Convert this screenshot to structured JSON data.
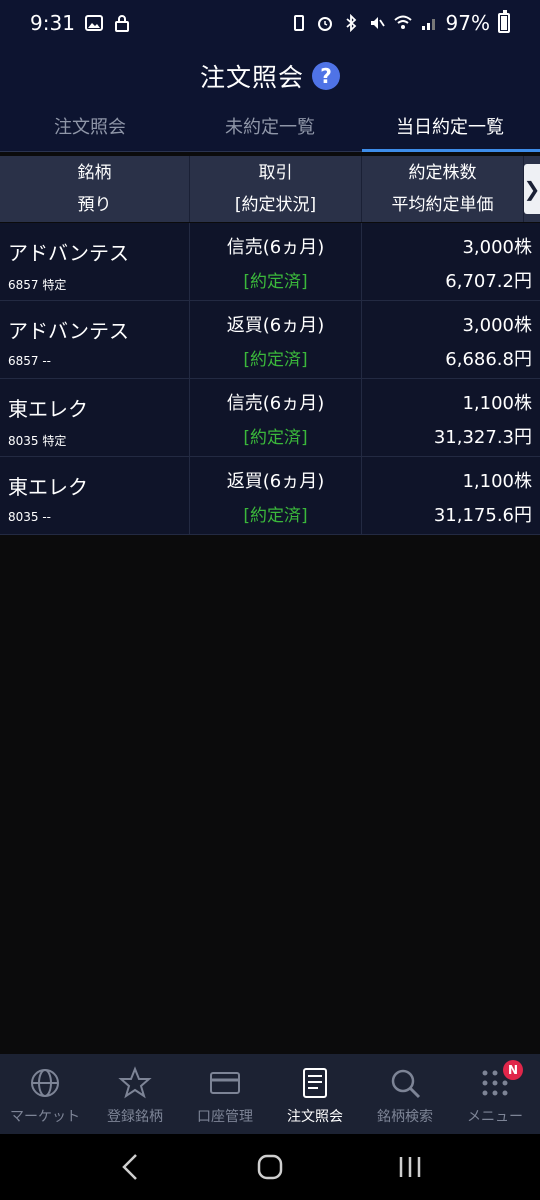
{
  "status_bar": {
    "time": "9:31",
    "battery": "97%"
  },
  "header": {
    "title": "注文照会",
    "help_icon": "question-icon",
    "accent_color": "#4f73e6"
  },
  "tabs": [
    {
      "label": "注文照会",
      "active": false
    },
    {
      "label": "未約定一覧",
      "active": false
    },
    {
      "label": "当日約定一覧",
      "active": true
    }
  ],
  "table": {
    "headers": {
      "col1_top": "銘柄",
      "col1_bottom": "預り",
      "col2_top": "取引",
      "col2_bottom": "[約定状況]",
      "col3_top": "約定株数",
      "col3_bottom": "平均約定単価",
      "scroll_arrow": "❯"
    },
    "rows": [
      {
        "name": "アドバンテス",
        "code": "6857 特定",
        "trade": "信売(6ヵ月)",
        "status": "[約定済]",
        "qty": "3,000株",
        "price": "6,707.2円"
      },
      {
        "name": "アドバンテス",
        "code": "6857 --",
        "trade": "返買(6ヵ月)",
        "status": "[約定済]",
        "qty": "3,000株",
        "price": "6,686.8円"
      },
      {
        "name": "東エレク",
        "code": "8035 特定",
        "trade": "信売(6ヵ月)",
        "status": "[約定済]",
        "qty": "1,100株",
        "price": "31,327.3円"
      },
      {
        "name": "東エレク",
        "code": "8035 --",
        "trade": "返買(6ヵ月)",
        "status": "[約定済]",
        "qty": "1,100株",
        "price": "31,175.6円"
      }
    ]
  },
  "bottom_nav": [
    {
      "label": "マーケット",
      "icon": "globe-icon",
      "active": false
    },
    {
      "label": "登録銘柄",
      "icon": "star-icon",
      "active": false
    },
    {
      "label": "口座管理",
      "icon": "card-icon",
      "active": false
    },
    {
      "label": "注文照会",
      "icon": "document-icon",
      "active": true
    },
    {
      "label": "銘柄検索",
      "icon": "search-icon",
      "active": false
    },
    {
      "label": "メニュー",
      "icon": "grid-icon",
      "active": false,
      "badge": "N"
    }
  ]
}
